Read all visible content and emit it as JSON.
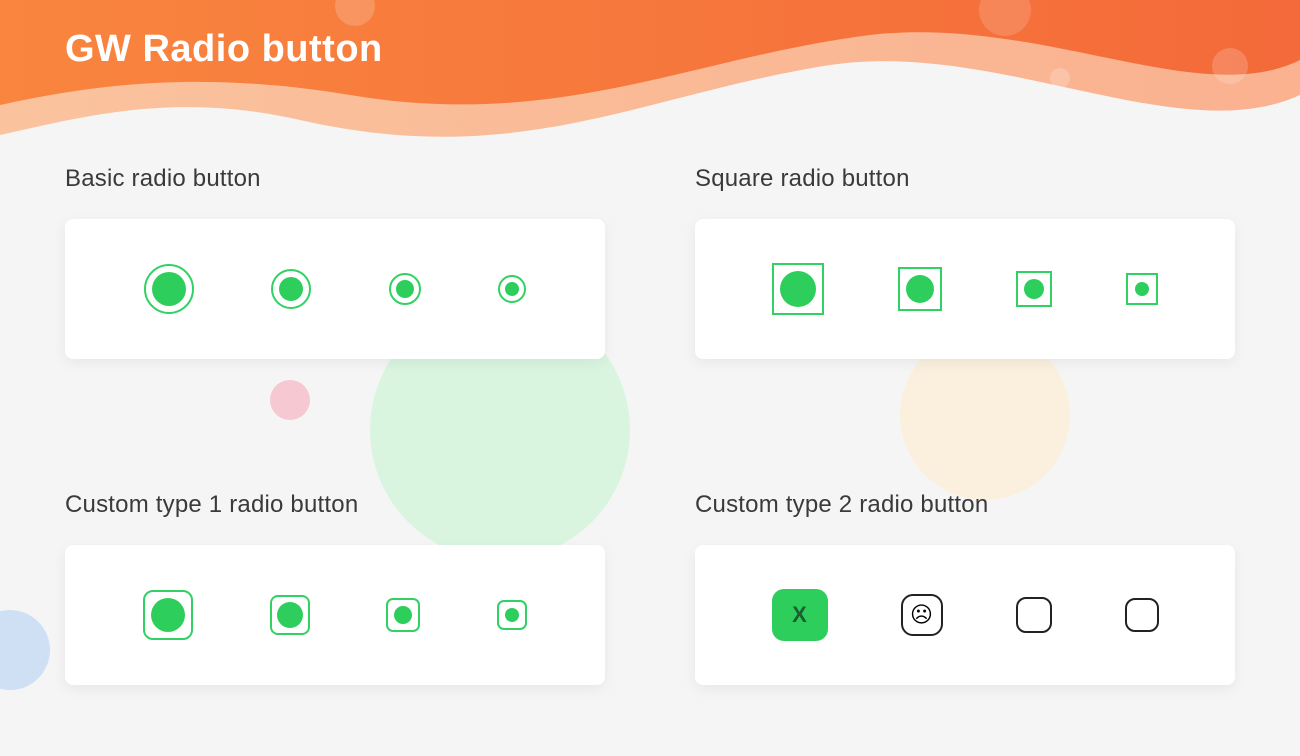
{
  "header": {
    "title": "GW Radio button"
  },
  "colors": {
    "accent": "#2ece5d",
    "text": "#3a3a3a",
    "card": "#ffffff"
  },
  "sections": {
    "basic": {
      "title": "Basic radio button"
    },
    "square": {
      "title": "Square radio button"
    },
    "custom1": {
      "title": "Custom type 1 radio button"
    },
    "custom2": {
      "title": "Custom type 2 radio button",
      "items": {
        "0": {
          "glyph": "X"
        },
        "1": {
          "glyph": "☹"
        },
        "2": {
          "glyph": ""
        },
        "3": {
          "glyph": ""
        }
      }
    }
  }
}
